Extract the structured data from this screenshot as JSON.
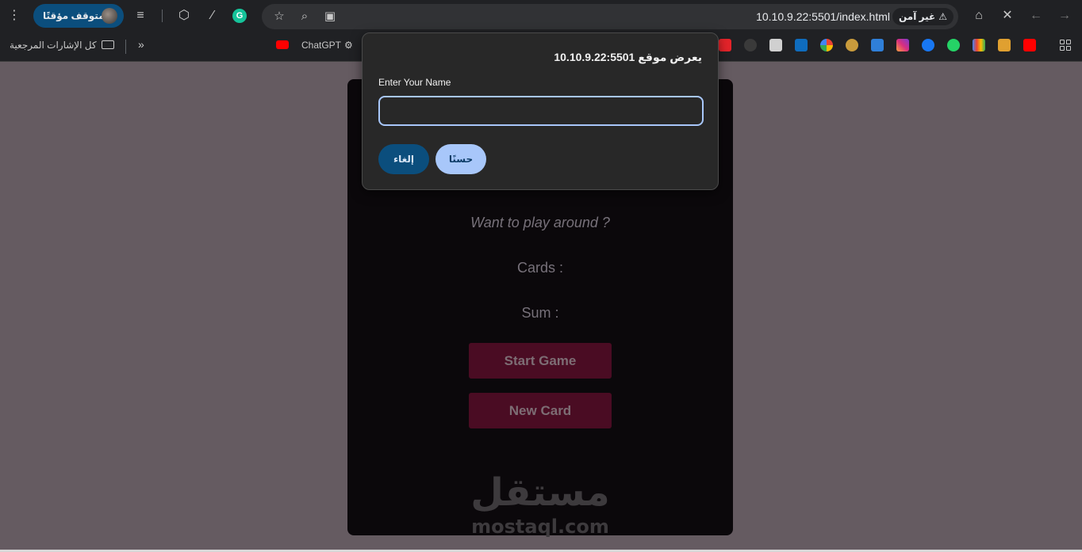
{
  "browser": {
    "url": "10.10.9.22:5501/index.html",
    "security_label": "غير آمن",
    "profile_label": "متوقف مؤقتًا",
    "extension_letter": "G"
  },
  "bookmarks": {
    "all_bookmarks_label": "كل الإشارات المرجعية",
    "more_label": "»",
    "chatgpt_label": "ChatGPT"
  },
  "game": {
    "message": "Want to play around ?",
    "cards_label": "Cards :",
    "sum_label": "Sum :",
    "start_button": "Start Game",
    "new_card_button": "New Card",
    "watermark_ar": "مستقل",
    "watermark_en": "mostaql.com"
  },
  "dialog": {
    "title": "يعرض موقع 10.10.9.22:5501",
    "label": "Enter Your Name",
    "input_value": "",
    "ok_button": "حسنًا",
    "cancel_button": "إلغاء"
  },
  "colors": {
    "page_bg": "#655b61",
    "card_bg": "#0b080b",
    "button_bg": "#4a0c23",
    "dialog_bg": "#282828",
    "accent": "#a8c7fa"
  }
}
